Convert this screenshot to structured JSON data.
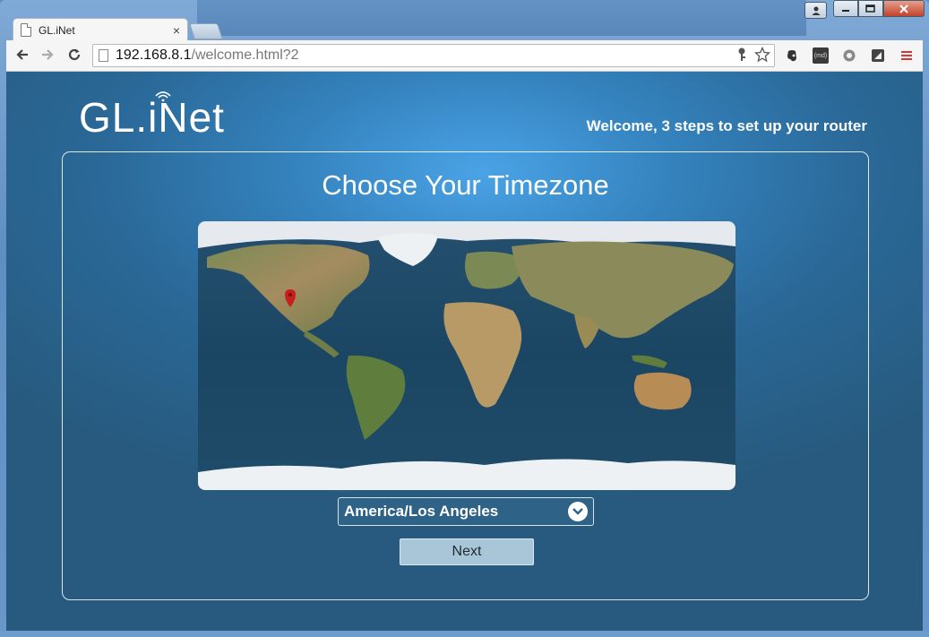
{
  "browser": {
    "tab_title": "GL.iNet",
    "tab_close": "×",
    "url_host": "192.168.8.1",
    "url_path": "/welcome.html?2",
    "ext_md_label": "(md)"
  },
  "page": {
    "logo_text": "GL.iNet",
    "welcome_text": "Welcome, 3 steps to set up your router",
    "heading": "Choose Your Timezone",
    "timezone_value": "America/Los Angeles",
    "next_label": "Next"
  },
  "colors": {
    "accent": "#2e6286",
    "button": "#a9c6d8",
    "pin": "#c81e1e"
  }
}
